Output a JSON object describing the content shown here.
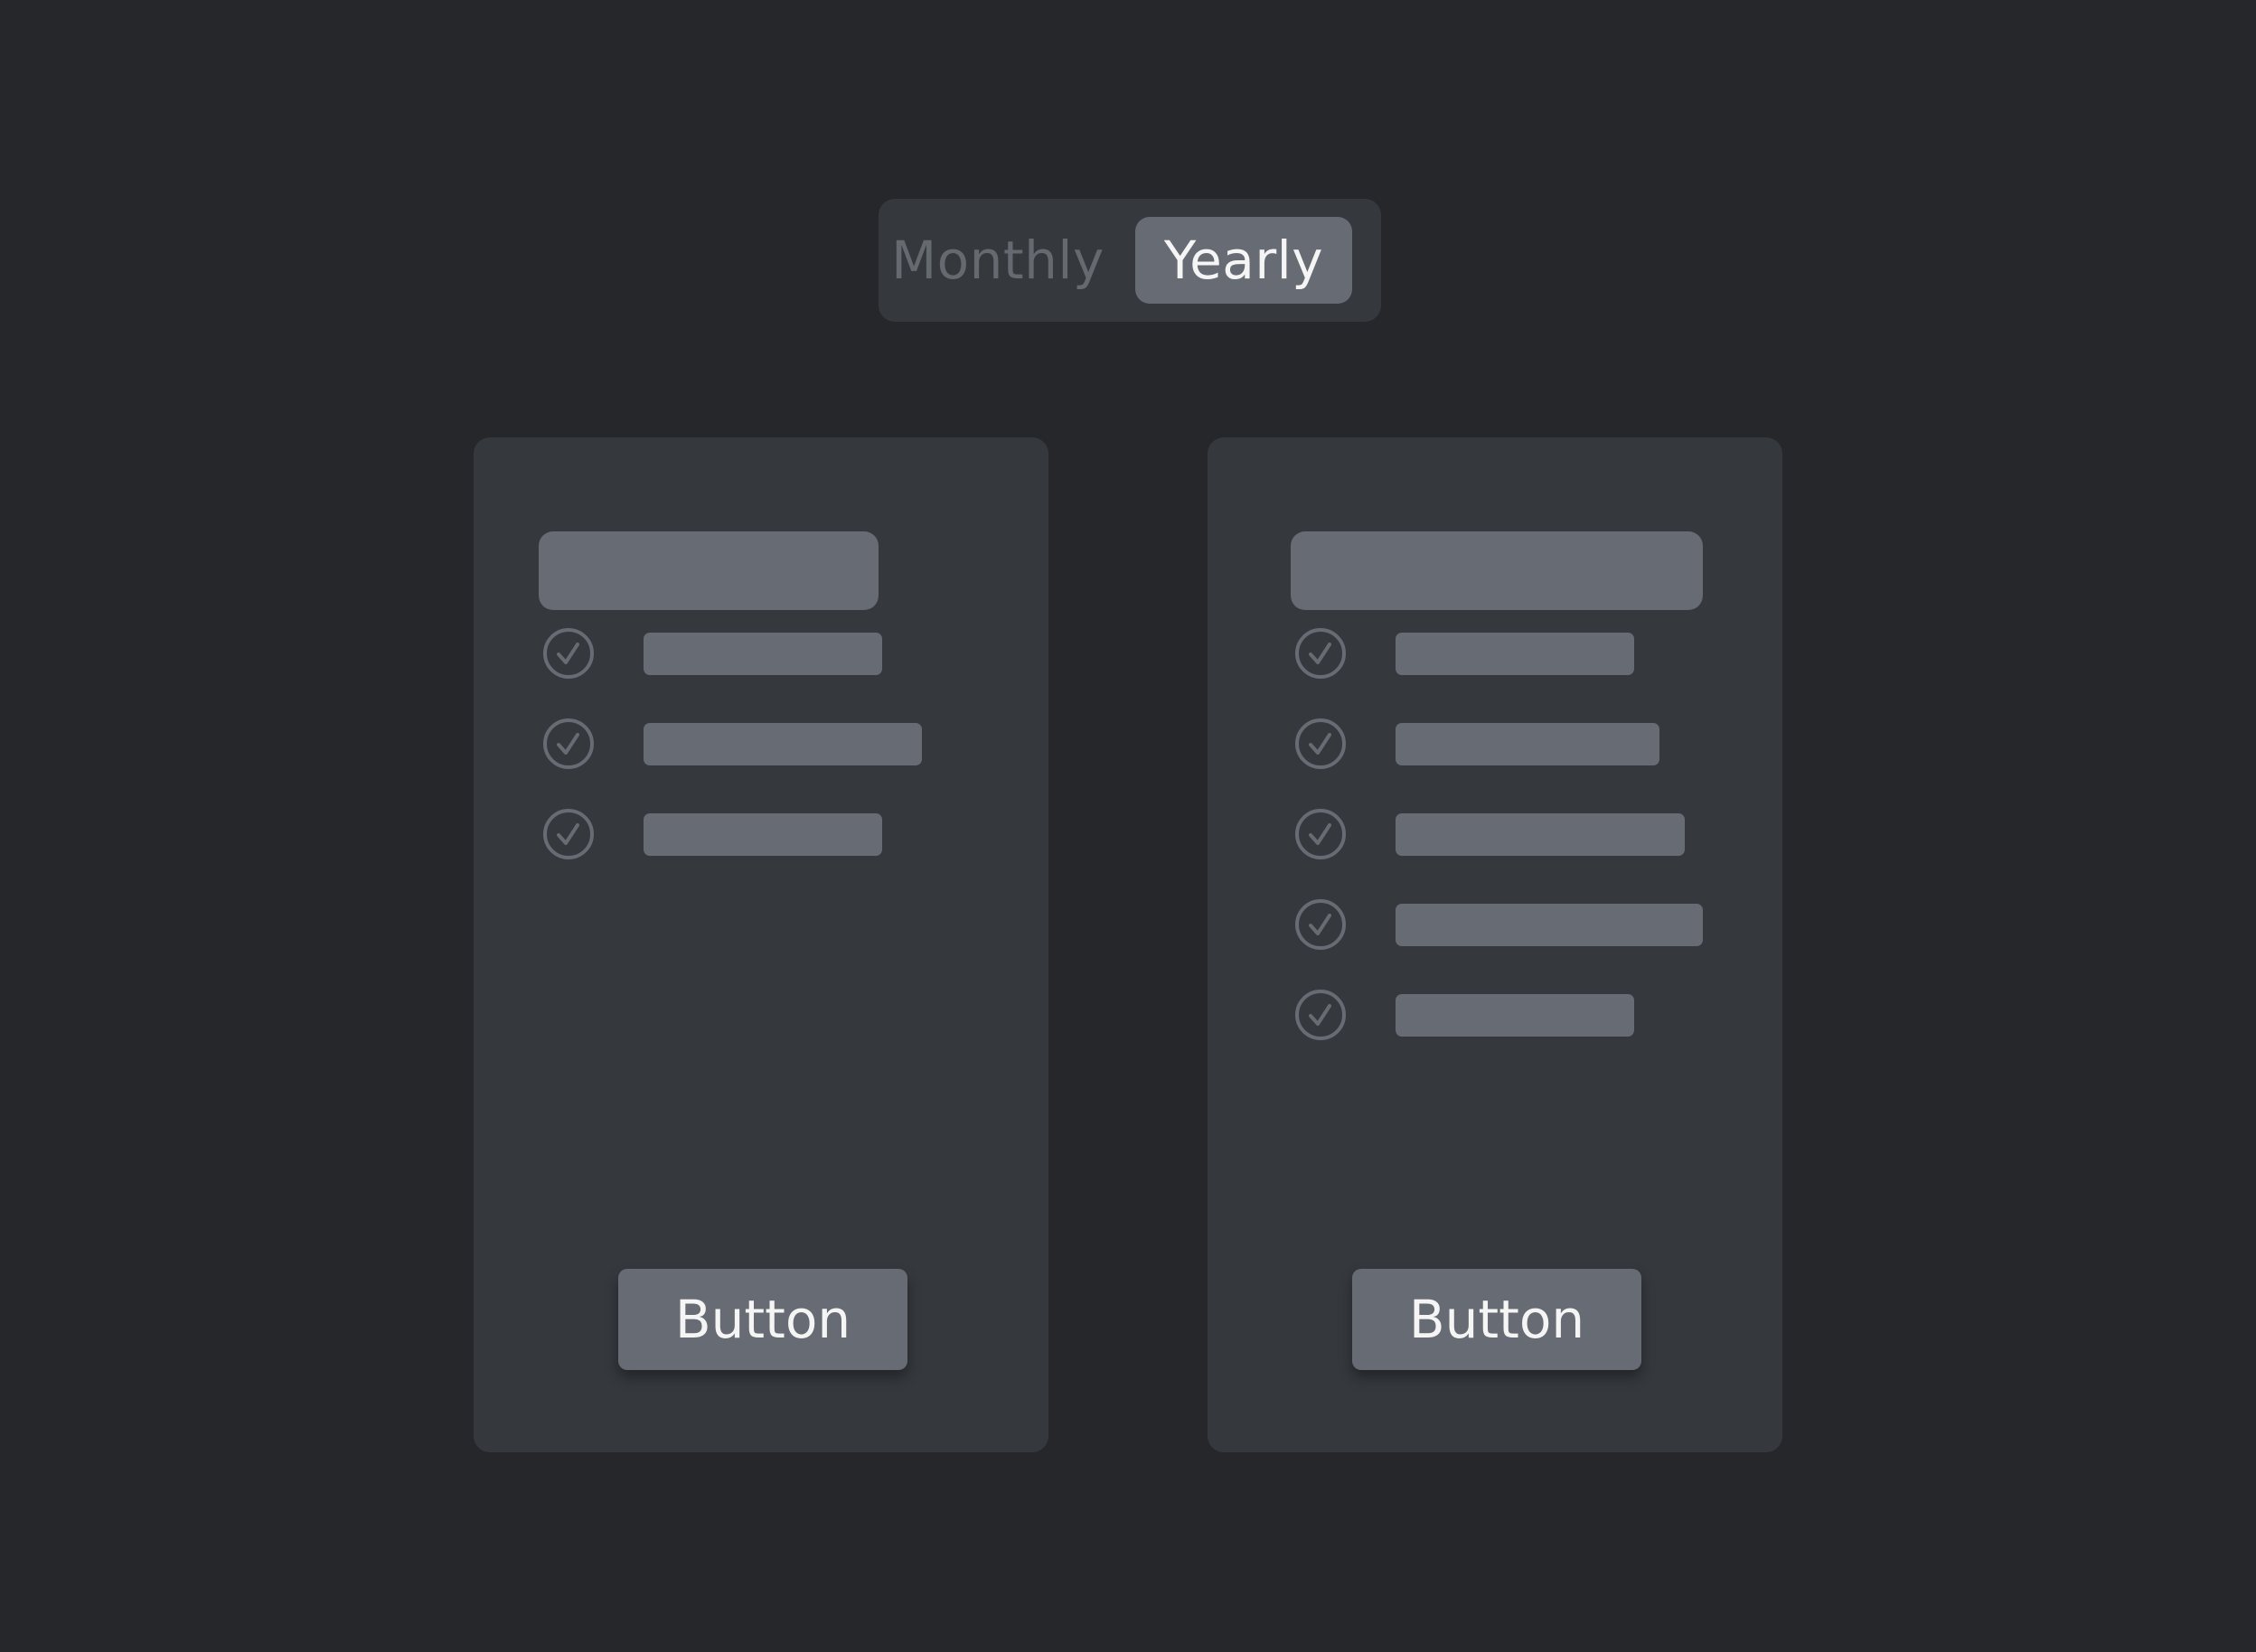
{
  "toggle": {
    "options": [
      {
        "label": "Monthly",
        "selected": false
      },
      {
        "label": "Yearly",
        "selected": true
      }
    ]
  },
  "colors": {
    "background": "#26272b",
    "card": "#35383d",
    "placeholder": "#676b73",
    "text_active": "#f5f5f6",
    "text_inactive": "#656970"
  },
  "plans": [
    {
      "features": [
        {
          "icon": "check-circle-icon"
        },
        {
          "icon": "check-circle-icon"
        },
        {
          "icon": "check-circle-icon"
        }
      ],
      "button_label": "Button"
    },
    {
      "features": [
        {
          "icon": "check-circle-icon"
        },
        {
          "icon": "check-circle-icon"
        },
        {
          "icon": "check-circle-icon"
        },
        {
          "icon": "check-circle-icon"
        },
        {
          "icon": "check-circle-icon"
        }
      ],
      "button_label": "Button"
    }
  ]
}
